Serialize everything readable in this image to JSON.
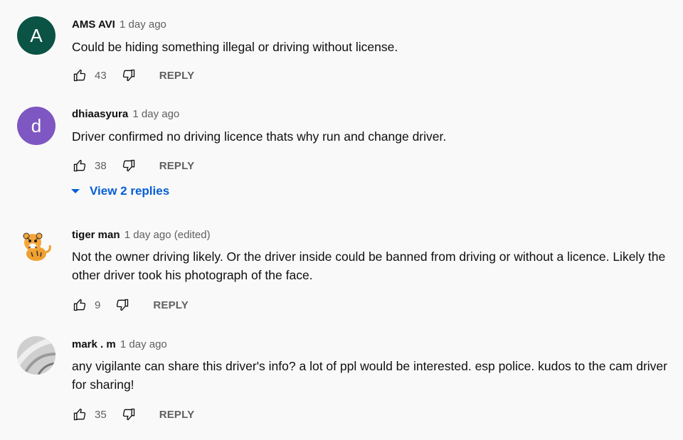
{
  "comments": [
    {
      "author": "AMS AVI",
      "time": "1 day ago",
      "text": "Could be hiding something illegal or driving without license.",
      "likes": "43",
      "reply_label": "REPLY",
      "avatar": {
        "letter": "A",
        "color": "#0b5345"
      }
    },
    {
      "author": "dhiaasyura",
      "time": "1 day ago",
      "text": "Driver confirmed no driving licence thats why run and change driver.",
      "likes": "38",
      "reply_label": "REPLY",
      "avatar": {
        "letter": "d",
        "color": "#7e57c2"
      },
      "view_replies": "View 2 replies"
    },
    {
      "author": "tiger man",
      "time": "1 day ago (edited)",
      "text": "Not the owner driving likely.  Or the driver inside could be banned from driving or without a licence. Likely the other driver took his photograph of the face.",
      "likes": "9",
      "reply_label": "REPLY",
      "avatar": {
        "icon": "tiger-avatar"
      }
    },
    {
      "author": "mark . m",
      "time": "1 day ago",
      "text": "any vigilante can share this driver's info? a lot of ppl would be interested. esp police. kudos to the cam driver for sharing!",
      "likes": "35",
      "reply_label": "REPLY",
      "avatar": {
        "icon": "gray-abstract-avatar"
      }
    }
  ],
  "colors": {
    "background": "#f9f9f9",
    "link": "#065fd4",
    "secondary_text": "#606060"
  }
}
